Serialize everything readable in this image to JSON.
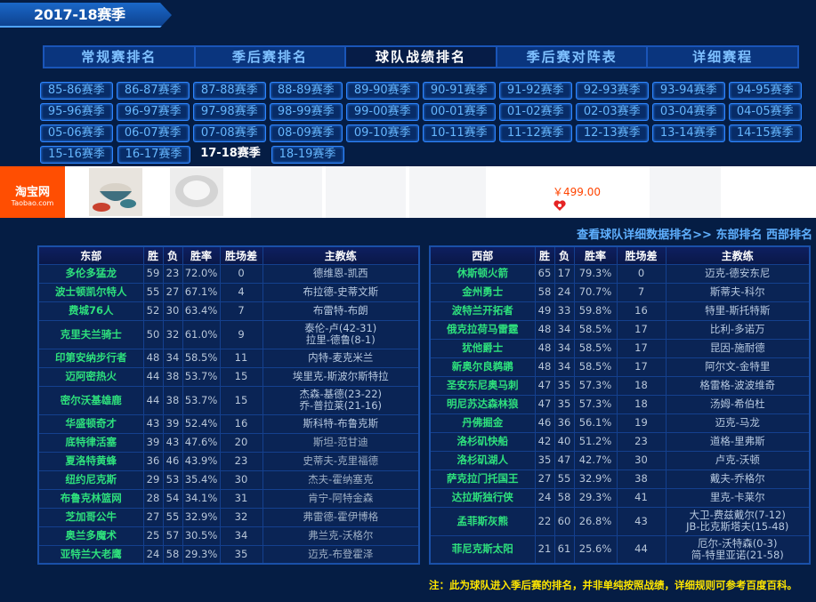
{
  "header": {
    "season_title": "2017-18赛季"
  },
  "nav": [
    "常规赛排名",
    "季后赛排名",
    "球队战绩排名",
    "季后赛对阵表",
    "详细赛程"
  ],
  "nav_active": 2,
  "seasons": [
    [
      "85-86赛季",
      "86-87赛季",
      "87-88赛季",
      "88-89赛季",
      "89-90赛季",
      "90-91赛季",
      "91-92赛季",
      "92-93赛季",
      "93-94赛季",
      "94-95赛季"
    ],
    [
      "95-96赛季",
      "96-97赛季",
      "97-98赛季",
      "98-99赛季",
      "99-00赛季",
      "00-01赛季",
      "01-02赛季",
      "02-03赛季",
      "03-04赛季",
      "04-05赛季"
    ],
    [
      "05-06赛季",
      "06-07赛季",
      "07-08赛季",
      "08-09赛季",
      "09-10赛季",
      "10-11赛季",
      "11-12赛季",
      "12-13赛季",
      "13-14赛季",
      "14-15赛季"
    ],
    [
      "15-16赛季",
      "16-17赛季",
      "17-18赛季",
      "18-19赛季"
    ]
  ],
  "active_season": "17-18赛季",
  "ad": {
    "brand": "淘宝网",
    "brand_sub": "Taobao.com",
    "price": "￥499.00"
  },
  "links": {
    "detail": "查看球队详细数据排名>>",
    "east": "东部排名",
    "west": "西部排名"
  },
  "east": {
    "headers": [
      "东部",
      "胜",
      "负",
      "胜率",
      "胜场差",
      "主教练"
    ],
    "rows": [
      [
        "多伦多猛龙",
        "59",
        "23",
        "72.0%",
        "0",
        [
          "德维恩-凯西"
        ]
      ],
      [
        "波士顿凯尔特人",
        "55",
        "27",
        "67.1%",
        "4",
        [
          "布拉德-史蒂文斯"
        ]
      ],
      [
        "费城76人",
        "52",
        "30",
        "63.4%",
        "7",
        [
          "布雷特-布朗"
        ]
      ],
      [
        "克里夫兰骑士",
        "50",
        "32",
        "61.0%",
        "9",
        [
          "泰伦-卢(42-31)",
          "拉里-德鲁(8-1)"
        ]
      ],
      [
        "印第安纳步行者",
        "48",
        "34",
        "58.5%",
        "11",
        [
          "内特-麦克米兰"
        ]
      ],
      [
        "迈阿密热火",
        "44",
        "38",
        "53.7%",
        "15",
        [
          "埃里克-斯波尔斯特拉"
        ]
      ],
      [
        "密尔沃基雄鹿",
        "44",
        "38",
        "53.7%",
        "15",
        [
          "杰森-基德(23-22)",
          "乔-普拉莱(21-16)"
        ]
      ],
      [
        "华盛顿奇才",
        "43",
        "39",
        "52.4%",
        "16",
        [
          "斯科特-布鲁克斯"
        ]
      ],
      [
        "底特律活塞",
        "39",
        "43",
        "47.6%",
        "20",
        [
          "斯坦-范甘迪"
        ]
      ],
      [
        "夏洛特黄蜂",
        "36",
        "46",
        "43.9%",
        "23",
        [
          "史蒂夫-克里福德"
        ]
      ],
      [
        "纽约尼克斯",
        "29",
        "53",
        "35.4%",
        "30",
        [
          "杰夫-霍纳塞克"
        ]
      ],
      [
        "布鲁克林篮网",
        "28",
        "54",
        "34.1%",
        "31",
        [
          "肯宁-阿特金森"
        ]
      ],
      [
        "芝加哥公牛",
        "27",
        "55",
        "32.9%",
        "32",
        [
          "弗雷德-霍伊博格"
        ]
      ],
      [
        "奥兰多魔术",
        "25",
        "57",
        "30.5%",
        "34",
        [
          "弗兰克-沃格尔"
        ]
      ],
      [
        "亚特兰大老鹰",
        "24",
        "58",
        "29.3%",
        "35",
        [
          "迈克-布登霍泽"
        ]
      ]
    ]
  },
  "west": {
    "headers": [
      "西部",
      "胜",
      "负",
      "胜率",
      "胜场差",
      "主教练"
    ],
    "rows": [
      [
        "休斯顿火箭",
        "65",
        "17",
        "79.3%",
        "0",
        [
          "迈克-德安东尼"
        ]
      ],
      [
        "金州勇士",
        "58",
        "24",
        "70.7%",
        "7",
        [
          "斯蒂夫-科尔"
        ]
      ],
      [
        "波特兰开拓者",
        "49",
        "33",
        "59.8%",
        "16",
        [
          "特里-斯托特斯"
        ]
      ],
      [
        "俄克拉荷马雷霆",
        "48",
        "34",
        "58.5%",
        "17",
        [
          "比利-多诺万"
        ]
      ],
      [
        "犹他爵士",
        "48",
        "34",
        "58.5%",
        "17",
        [
          "昆因-施耐德"
        ]
      ],
      [
        "新奥尔良鹈鹕",
        "48",
        "34",
        "58.5%",
        "17",
        [
          "阿尔文-金特里"
        ]
      ],
      [
        "圣安东尼奥马刺",
        "47",
        "35",
        "57.3%",
        "18",
        [
          "格雷格-波波维奇"
        ]
      ],
      [
        "明尼苏达森林狼",
        "47",
        "35",
        "57.3%",
        "18",
        [
          "汤姆-希伯杜"
        ]
      ],
      [
        "丹佛掘金",
        "46",
        "36",
        "56.1%",
        "19",
        [
          "迈克-马龙"
        ]
      ],
      [
        "洛杉矶快船",
        "42",
        "40",
        "51.2%",
        "23",
        [
          "道格-里弗斯"
        ]
      ],
      [
        "洛杉矶湖人",
        "35",
        "47",
        "42.7%",
        "30",
        [
          "卢克-沃顿"
        ]
      ],
      [
        "萨克拉门托国王",
        "27",
        "55",
        "32.9%",
        "38",
        [
          "戴夫-乔格尔"
        ]
      ],
      [
        "达拉斯独行侠",
        "24",
        "58",
        "29.3%",
        "41",
        [
          "里克-卡莱尔"
        ]
      ],
      [
        "孟菲斯灰熊",
        "22",
        "60",
        "26.8%",
        "43",
        [
          "大卫-费兹戴尔(7-12)",
          "JB-比克斯塔夫(15-48)"
        ]
      ],
      [
        "菲尼克斯太阳",
        "21",
        "61",
        "25.6%",
        "44",
        [
          "厄尔-沃特森(0-3)",
          "简-特里亚诺(21-58)"
        ]
      ]
    ]
  },
  "note": "注：此为球队进入季后赛的排名，并非单纯按照战绩，详细规则可参考百度百科。",
  "colors": {
    "background": "#051d44",
    "team": "#2ee07c",
    "link": "#5fb0ff",
    "note": "#ffe600",
    "price": "#ff4400",
    "taobao": "#ff4e02"
  }
}
